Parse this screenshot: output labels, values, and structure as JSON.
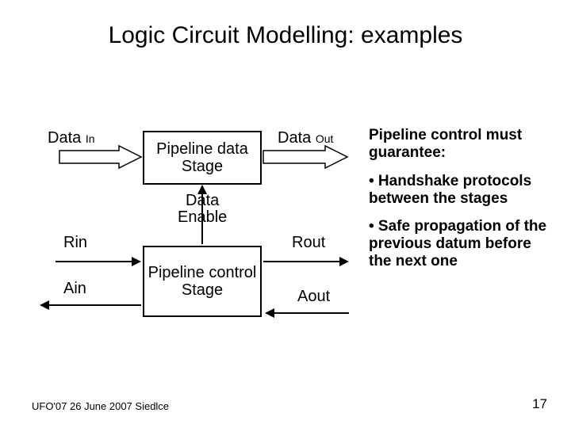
{
  "title": "Logic Circuit Modelling: examples",
  "diagram": {
    "data_in_label": "Data",
    "data_in_sub": "In",
    "data_out_label": "Data",
    "data_out_sub": "Out",
    "pipeline_data_stage_l1": "Pipeline data",
    "pipeline_data_stage_l2": "Stage",
    "data_enable_l1": "Data",
    "data_enable_l2": "Enable",
    "rin": "Rin",
    "rout": "Rout",
    "ain": "Ain",
    "aout": "Aout",
    "pipeline_control_stage_l1": "Pipeline control",
    "pipeline_control_stage_l2": "Stage"
  },
  "notes": {
    "lead": "Pipeline control must guarantee:",
    "b1": "• Handshake protocols between the stages",
    "b2": "• Safe propagation of the previous datum before the next one"
  },
  "footer": {
    "left": "UFO'07 26 June 2007 Siedlce",
    "page": "17"
  }
}
